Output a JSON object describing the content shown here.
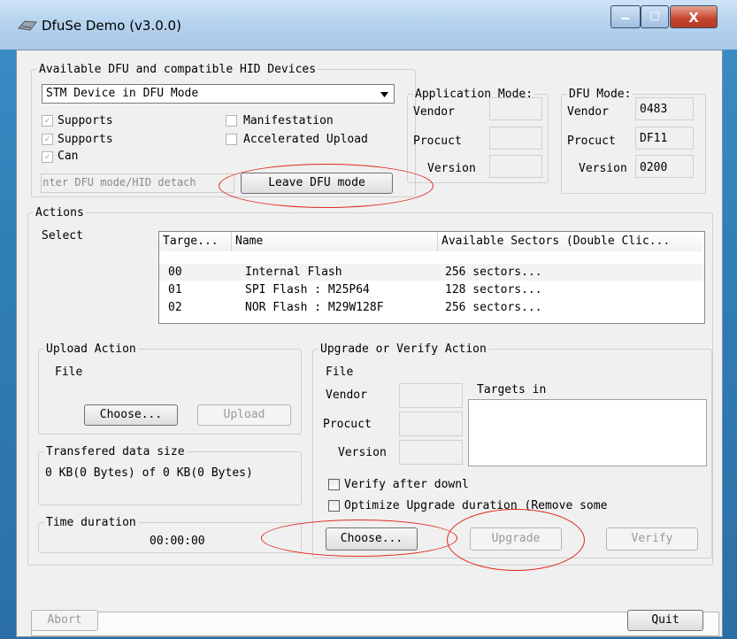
{
  "window": {
    "title": "DfuSe Demo (v3.0.0)",
    "minimize_glyph": "‒",
    "maximize_glyph": "☐",
    "close_glyph": "X"
  },
  "devices": {
    "legend": "Available DFU and compatible HID Devices",
    "selected": "STM Device in DFU Mode",
    "checkboxes": {
      "supports1": "Supports",
      "supports2": "Supports",
      "can": "Can",
      "manifestation": "Manifestation",
      "accelerated_upload": "Accelerated Upload"
    },
    "hid_detach_text": "Enter DFU mode/HID detach",
    "leave_dfu_button": "Leave DFU mode"
  },
  "application_mode": {
    "legend": "Application Mode:",
    "vendor_label": "Vendor",
    "product_label": "Procuct",
    "version_label": "Version",
    "vendor_value": "",
    "product_value": "",
    "version_value": ""
  },
  "dfu_mode": {
    "legend": "DFU Mode:",
    "vendor_label": "Vendor",
    "product_label": "Procuct",
    "version_label": "Version",
    "vendor_value": "0483",
    "product_value": "DF11",
    "version_value": "0200"
  },
  "actions": {
    "legend": "Actions",
    "select_label": "Select",
    "columns": [
      "Targe...",
      "Name",
      "Available Sectors (Double Clic..."
    ],
    "rows": [
      {
        "target": "00",
        "name": "Internal Flash",
        "sectors": "256 sectors..."
      },
      {
        "target": "01",
        "name": "SPI Flash : M25P64",
        "sectors": "128 sectors..."
      },
      {
        "target": "02",
        "name": "NOR Flash : M29W128F",
        "sectors": "256 sectors..."
      }
    ]
  },
  "upload": {
    "legend": "Upload Action",
    "file_label": "File",
    "choose_button": "Choose...",
    "upload_button": "Upload"
  },
  "transfer": {
    "legend": "Transfered data size",
    "text": "0 KB(0 Bytes) of 0 KB(0 Bytes)"
  },
  "time": {
    "legend": "Time duration",
    "value": "00:00:00"
  },
  "upgrade": {
    "legend": "Upgrade or Verify Action",
    "file_label": "File",
    "vendor_label": "Vendor",
    "product_label": "Procuct",
    "version_label": "Version",
    "targets_label": "Targets in",
    "verify_after": "Verify after downl",
    "optimize": "Optimize Upgrade duration (Remove some",
    "choose_button": "Choose...",
    "upgrade_button": "Upgrade",
    "verify_button": "Verify"
  },
  "footer": {
    "abort_button": "Abort",
    "quit_button": "Quit"
  },
  "colors": {
    "annotation_red": "#e0281f"
  }
}
